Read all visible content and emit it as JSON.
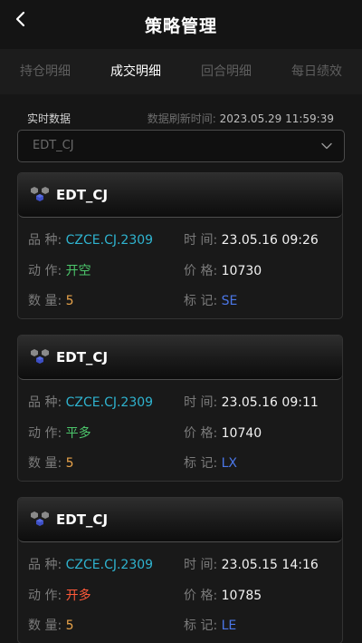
{
  "header": {
    "title": "策略管理",
    "back_icon": "chevron-left-icon"
  },
  "tabs": [
    {
      "label": "持仓明细",
      "active": false
    },
    {
      "label": "成交明细",
      "active": true
    },
    {
      "label": "回合明细",
      "active": false
    },
    {
      "label": "每日绩效",
      "active": false
    }
  ],
  "meta": {
    "label": "实时数据",
    "refresh_label": "数据刷新时间:",
    "refresh_time": "2023.05.29 11:59:39"
  },
  "select": {
    "value": "EDT_CJ",
    "icon": "chevron-down-icon"
  },
  "field_labels": {
    "variety": "品 种:",
    "time": "时 间:",
    "action": "动 作:",
    "price": "价 格:",
    "quantity": "数 量:",
    "mark": "标 记:"
  },
  "colors": {
    "code": "#2fb3cf",
    "open_short": "#4cc66b",
    "close_long": "#4cc66b",
    "open_long": "#ff5a3a",
    "quantity": "#e8a34a",
    "mark": "#4b77e8"
  },
  "cards": [
    {
      "title": "EDT_CJ",
      "variety": "CZCE.CJ.2309",
      "time": "23.05.16 09:26",
      "action": "开空",
      "price": "10730",
      "quantity": "5",
      "mark": "SE"
    },
    {
      "title": "EDT_CJ",
      "variety": "CZCE.CJ.2309",
      "time": "23.05.16 09:11",
      "action": "平多",
      "price": "10740",
      "quantity": "5",
      "mark": "LX"
    },
    {
      "title": "EDT_CJ",
      "variety": "CZCE.CJ.2309",
      "time": "23.05.15 14:16",
      "action": "开多",
      "price": "10785",
      "quantity": "5",
      "mark": "LE"
    }
  ]
}
